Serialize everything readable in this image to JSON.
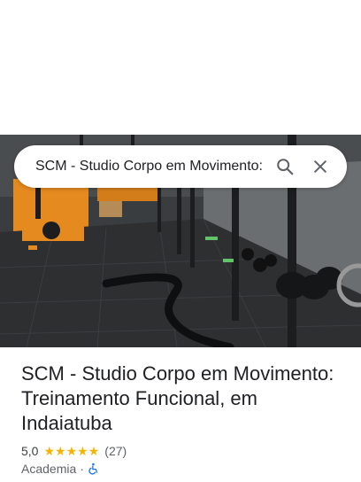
{
  "search": {
    "query": "SCM - Studio Corpo em Movimento:",
    "search_icon": "search-icon",
    "close_icon": "close-icon"
  },
  "photo": {
    "description_icon": "gym-photo"
  },
  "place": {
    "title": "SCM - Studio Corpo em Movimento: Treinamento Funcional, em Indaiatuba",
    "rating": "5,0",
    "stars": 5,
    "reviews": "(27)",
    "category": "Academia",
    "separator": "·",
    "accessibility_icon": "wheelchair-icon"
  },
  "colors": {
    "star": "#f4b400",
    "accessible_icon": "#1a73e8",
    "text_primary": "#202124",
    "text_secondary": "#5f6368"
  }
}
